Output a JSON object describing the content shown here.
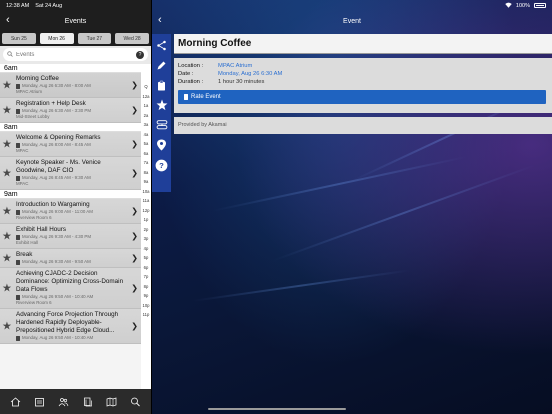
{
  "status_bar": {
    "time": "12:38 AM",
    "date": "Sat 24 Aug",
    "battery_text": "100%"
  },
  "left_nav": {
    "back_icon": "chevron-left-icon",
    "title": "Events"
  },
  "day_tabs": [
    {
      "label": "Sun 25",
      "active": false
    },
    {
      "label": "Mon 26",
      "active": true
    },
    {
      "label": "Tue 27",
      "active": false
    },
    {
      "label": "Wed 28",
      "active": false
    }
  ],
  "search": {
    "placeholder": "Events",
    "help_icon": "?"
  },
  "event_groups": [
    {
      "time": "6am",
      "events": [
        {
          "title": "Morning Coffee",
          "meta": "Monday, Aug 26 6:30 AM - 8:00 AM",
          "location": "MPAC Atrium",
          "selected": true
        },
        {
          "title": "Registration + Help Desk",
          "meta": "Monday, Aug 26 6:30 AM - 3:30 PM",
          "location": "Mid-Street Lobby",
          "selected": false
        }
      ]
    },
    {
      "time": "8am",
      "events": [
        {
          "title": "Welcome & Opening Remarks",
          "meta": "Monday, Aug 26 8:00 AM - 8:45 AM",
          "location": "MPAC",
          "selected": false
        },
        {
          "title": "Keynote Speaker - Ms. Venice Goodwine, DAF CIO",
          "meta": "Monday, Aug 26 8:45 AM - 9:30 AM",
          "location": "MPAC",
          "selected": false
        }
      ]
    },
    {
      "time": "9am",
      "events": [
        {
          "title": "Introduction to Wargaming",
          "meta": "Monday, Aug 26 9:00 AM - 11:00 AM",
          "location": "Riverview Room 6",
          "selected": false
        },
        {
          "title": "Exhibit Hall Hours",
          "meta": "Monday, Aug 26 9:30 AM - 4:30 PM",
          "location": "Exhibit Hall",
          "selected": false
        },
        {
          "title": "Break",
          "meta": "Monday, Aug 26 9:30 AM - 9:50 AM",
          "location": "",
          "selected": false
        },
        {
          "title": "Achieving CJADC-2 Decision Dominance: Optimizing Cross-Domain Data Flows",
          "meta": "Monday, Aug 26 9:50 AM - 10:40 AM",
          "location": "Riverview Room 6",
          "selected": false
        },
        {
          "title": "Advancing Force Projection Through Hardened Rapidly Deployable-Prepositioned Hybrid Edge Cloud...",
          "meta": "Monday, Aug 26 9:50 AM - 10:40 AM",
          "location": "",
          "selected": false
        }
      ]
    }
  ],
  "index_bar": [
    "Q",
    "12a",
    "1a",
    "2a",
    "3a",
    "4a",
    "5a",
    "6a",
    "7a",
    "8a",
    "9a",
    "10a",
    "11a",
    "12p",
    "1p",
    "2p",
    "3p",
    "4p",
    "5p",
    "6p",
    "7p",
    "8p",
    "9p",
    "10p",
    "11p"
  ],
  "bottom_tabs": [
    "home-icon",
    "schedule-icon",
    "people-icon",
    "documents-icon",
    "map-icon",
    "search-icon"
  ],
  "right_nav": {
    "title": "Event",
    "back_icon": "chevron-left-icon"
  },
  "side_tools": [
    "share-icon",
    "edit-icon",
    "clipboard-icon",
    "star-icon",
    "info-stack-icon",
    "location-pin-icon",
    "help-icon"
  ],
  "detail": {
    "title": "Morning Coffee",
    "location_label": "Location :",
    "location_value": "MPAC Atrium",
    "date_label": "Date :",
    "date_value": "Monday, Aug 26 6:30 AM",
    "duration_label": "Duration :",
    "duration_value": "1 hour 30 minutes",
    "rate_button": "Rate Event",
    "provided_by": "Provided by Akamai"
  },
  "colors": {
    "toolbar_blue": "#1f3f99",
    "button_blue": "#1f63c0",
    "link_blue": "#2b6fd1"
  }
}
